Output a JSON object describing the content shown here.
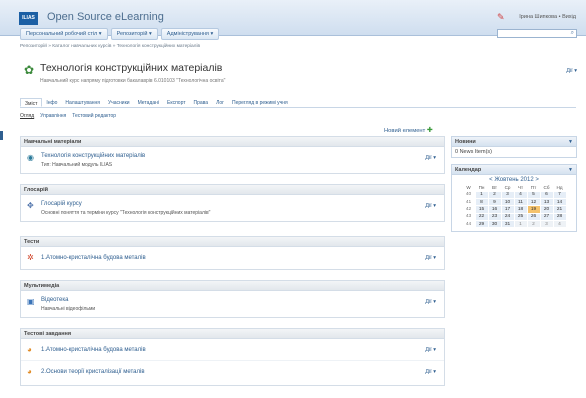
{
  "header": {
    "logo_text": "ILIAS",
    "app_title": "Open Source eLearning",
    "user_name": "Ірина Шипкова • Вихід"
  },
  "main_menu": [
    {
      "label": "Персональний робочий стіл ▾"
    },
    {
      "label": "Репозиторій ▾"
    },
    {
      "label": "Адміністрування ▾"
    }
  ],
  "breadcrumb": "Репозиторій » Каталог навчальних курсів » Технологія конструкційних матеріалів",
  "object": {
    "title": "Технологія конструкційних матеріалів",
    "description": "Навчальний курс напряму підготовки бакалаврів 6.010103 \"Технологічна освіта\"",
    "actions": "Дії ▾"
  },
  "tabs": [
    {
      "label": "Зміст"
    },
    {
      "label": "Інфо"
    },
    {
      "label": "Налаштування"
    },
    {
      "label": "Учасники"
    },
    {
      "label": "Метадані"
    },
    {
      "label": "Експорт"
    },
    {
      "label": "Права"
    },
    {
      "label": "Лог"
    },
    {
      "label": "Перегляд в режимі учня"
    }
  ],
  "subtabs": [
    {
      "label": "Огляд"
    },
    {
      "label": "Управління"
    },
    {
      "label": "Тестовий редактор"
    }
  ],
  "new_item": "Новий елемент",
  "sections": [
    {
      "title": "Навчальні матеріали",
      "items": [
        {
          "icon": "learning-module-icon",
          "title": "Технологія конструкційних матеріалів",
          "sub": "Тип: Навчальний модуль ILIAS",
          "actions": "Дії ▾"
        }
      ]
    },
    {
      "title": "Глосарій",
      "items": [
        {
          "icon": "glossary-icon",
          "title": "Глосарій курсу",
          "sub": "Основні поняття та терміни курсу \"Технологія конструкційних матеріалів\"",
          "actions": "Дії ▾"
        }
      ]
    },
    {
      "title": "Тести",
      "items": [
        {
          "icon": "test-icon",
          "title": "1.Атомно-кристалічна будова металів",
          "sub": "",
          "actions": "Дії ▾"
        }
      ]
    },
    {
      "title": "Мультимедіа",
      "items": [
        {
          "icon": "video-icon",
          "title": "Відеотека",
          "sub": "Навчальні відеофільми",
          "actions": "Дії ▾"
        }
      ]
    },
    {
      "title": "Тестові завдання",
      "items": [
        {
          "icon": "exercise-icon",
          "title": "1.Атомно-кристалічна будова металів",
          "sub": "",
          "actions": "Дії ▾"
        },
        {
          "icon": "exercise-icon",
          "title": "2.Основи теорії кристалізації металів",
          "sub": "",
          "actions": "Дії ▾"
        }
      ]
    }
  ],
  "news": {
    "title": "Новини",
    "body": "0 News Item(s)"
  },
  "calendar": {
    "title": "Календар",
    "month": "< Жовтень 2012 >",
    "weekday_headers": [
      "W",
      "Пн",
      "Вт",
      "Ср",
      "Чт",
      "Пт",
      "Сб",
      "Нд"
    ],
    "weeks": [
      [
        "40",
        "1",
        "2",
        "3",
        "4",
        "5",
        "6",
        "7"
      ],
      [
        "41",
        "8",
        "9",
        "10",
        "11",
        "12",
        "13",
        "14"
      ],
      [
        "42",
        "15",
        "16",
        "17",
        "18",
        "19",
        "20",
        "21"
      ],
      [
        "43",
        "22",
        "23",
        "24",
        "25",
        "26",
        "27",
        "28"
      ],
      [
        "44",
        "29",
        "30",
        "31",
        "1",
        "2",
        "3",
        "4"
      ]
    ],
    "today": "19"
  }
}
